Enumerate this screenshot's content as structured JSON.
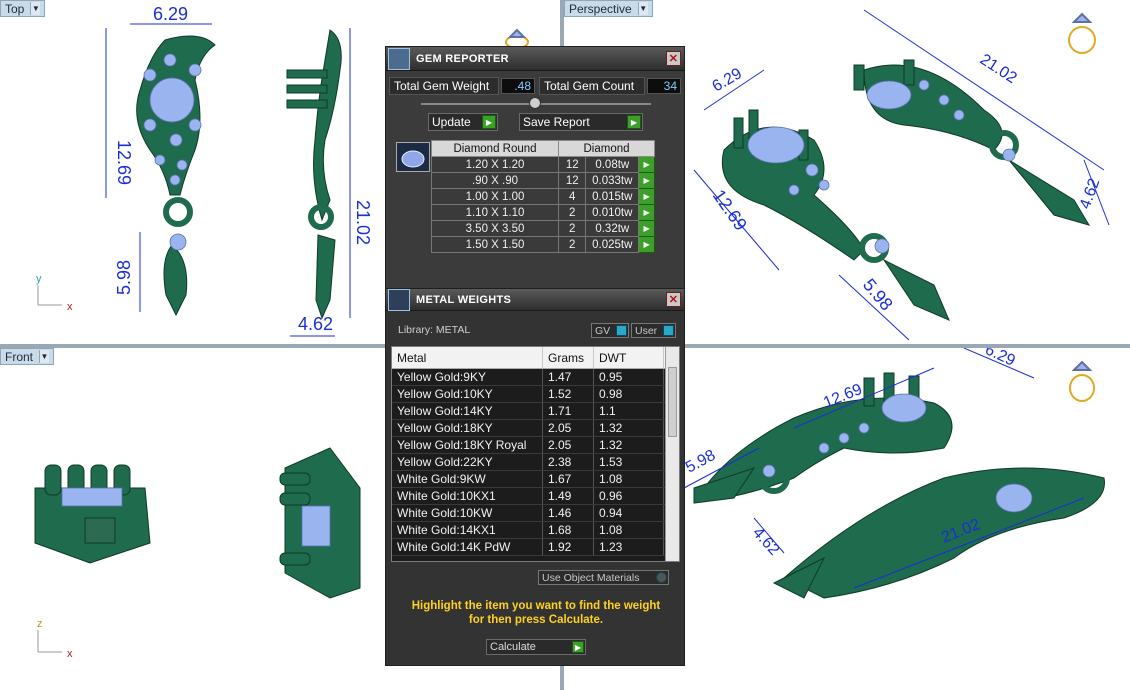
{
  "viewports": {
    "top": {
      "label": "Top",
      "dims": [
        "6.29",
        "12.69",
        "21.02",
        "5.98",
        "4.62"
      ],
      "axes": [
        "y",
        "x"
      ]
    },
    "perspective": {
      "label": "Perspective",
      "dims": [
        "6.29",
        "21.02",
        "12.69",
        "5.98",
        "4.62"
      ]
    },
    "front": {
      "label": "Front",
      "axes": [
        "z",
        "x"
      ]
    },
    "iso": {
      "dims": [
        "6.29",
        "12.69",
        "5.98",
        "21.02",
        "4.62"
      ]
    }
  },
  "gem_reporter": {
    "title": "GEM REPORTER",
    "total_weight_label": "Total Gem Weight",
    "total_weight_value": ".48",
    "total_count_label": "Total Gem Count",
    "total_count_value": "34",
    "update_label": "Update",
    "save_report_label": "Save Report",
    "table_headers": [
      "Diamond Round",
      "Diamond"
    ],
    "rows": [
      {
        "size": "1.20 X 1.20",
        "count": "12",
        "tw": "0.08tw"
      },
      {
        "size": ".90 X .90",
        "count": "12",
        "tw": "0.033tw"
      },
      {
        "size": "1.00 X 1.00",
        "count": "4",
        "tw": "0.015tw"
      },
      {
        "size": "1.10 X 1.10",
        "count": "2",
        "tw": "0.010tw"
      },
      {
        "size": "3.50 X 3.50",
        "count": "2",
        "tw": "0.32tw"
      },
      {
        "size": "1.50 X 1.50",
        "count": "2",
        "tw": "0.025tw"
      }
    ]
  },
  "metal_weights": {
    "title": "METAL WEIGHTS",
    "library_label": "Library: METAL",
    "gv_label": "GV",
    "user_label": "User",
    "columns": [
      "Metal",
      "Grams",
      "DWT"
    ],
    "rows": [
      {
        "metal": "Yellow Gold:9KY",
        "grams": "1.47",
        "dwt": "0.95"
      },
      {
        "metal": "Yellow Gold:10KY",
        "grams": "1.52",
        "dwt": "0.98"
      },
      {
        "metal": "Yellow Gold:14KY",
        "grams": "1.71",
        "dwt": "1.1"
      },
      {
        "metal": "Yellow Gold:18KY",
        "grams": "2.05",
        "dwt": "1.32"
      },
      {
        "metal": "Yellow Gold:18KY Royal",
        "grams": "2.05",
        "dwt": "1.32"
      },
      {
        "metal": "Yellow Gold:22KY",
        "grams": "2.38",
        "dwt": "1.53"
      },
      {
        "metal": "White Gold:9KW",
        "grams": "1.67",
        "dwt": "1.08"
      },
      {
        "metal": "White Gold:10KX1",
        "grams": "1.49",
        "dwt": "0.96"
      },
      {
        "metal": "White Gold:10KW",
        "grams": "1.46",
        "dwt": "0.94"
      },
      {
        "metal": "White Gold:14KX1",
        "grams": "1.68",
        "dwt": "1.08"
      },
      {
        "metal": "White Gold:14K PdW",
        "grams": "1.92",
        "dwt": "1.23"
      }
    ],
    "use_object_materials_label": "Use Object Materials",
    "hint_line1": "Highlight the item you want to find the weight",
    "hint_line2": "for then press Calculate.",
    "calculate_label": "Calculate"
  },
  "colors": {
    "metal_green": "#1f6b4d",
    "gem_blue": "#9ab4f0",
    "dim_blue": "#1a2ed8",
    "panel_bg": "#3b3b3b"
  }
}
